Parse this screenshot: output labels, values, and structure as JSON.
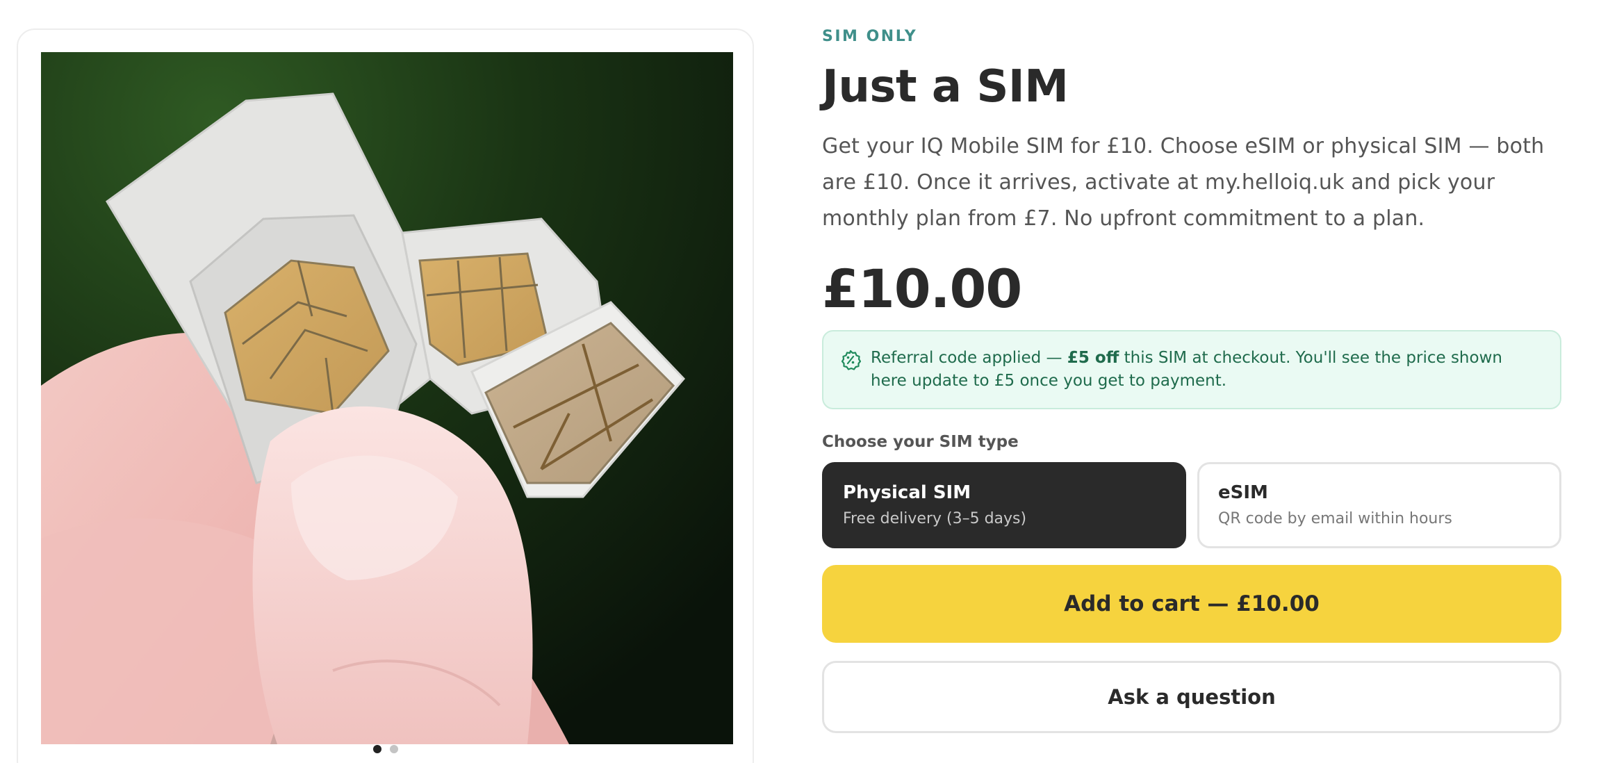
{
  "product": {
    "eyebrow": "SIM ONLY",
    "title": "Just a SIM",
    "description": "Get your IQ Mobile SIM for £10. Choose eSIM or physical SIM — both are £10. Once it arrives, activate at my.helloiq.uk and pick your monthly plan from £7. No upfront commitment to a plan.",
    "price": "£10.00"
  },
  "referral": {
    "icon": "discount-badge-icon",
    "prefix": "Referral code applied — ",
    "highlight": "£5 off",
    "suffix": " this SIM at checkout. You'll see the price shown here update to £5 once you get to payment."
  },
  "sim_type": {
    "label": "Choose your SIM type",
    "options": [
      {
        "title": "Physical SIM",
        "subtitle": "Free delivery (3–5 days)",
        "selected": true
      },
      {
        "title": "eSIM",
        "subtitle": "QR code by email within hours",
        "selected": false
      }
    ]
  },
  "actions": {
    "add_to_cart": "Add to cart — £10.00",
    "ask_question": "Ask a question"
  },
  "gallery": {
    "image": "photo-of-sim-cards-held-between-fingers",
    "slides": 2,
    "active_slide": 1
  },
  "colors": {
    "eyebrow": "#3f8f8a",
    "accent_button": "#f6d33e",
    "selected_option": "#2a2a2a",
    "referral_bg": "#eafaf3",
    "referral_text": "#1f6b4c"
  }
}
